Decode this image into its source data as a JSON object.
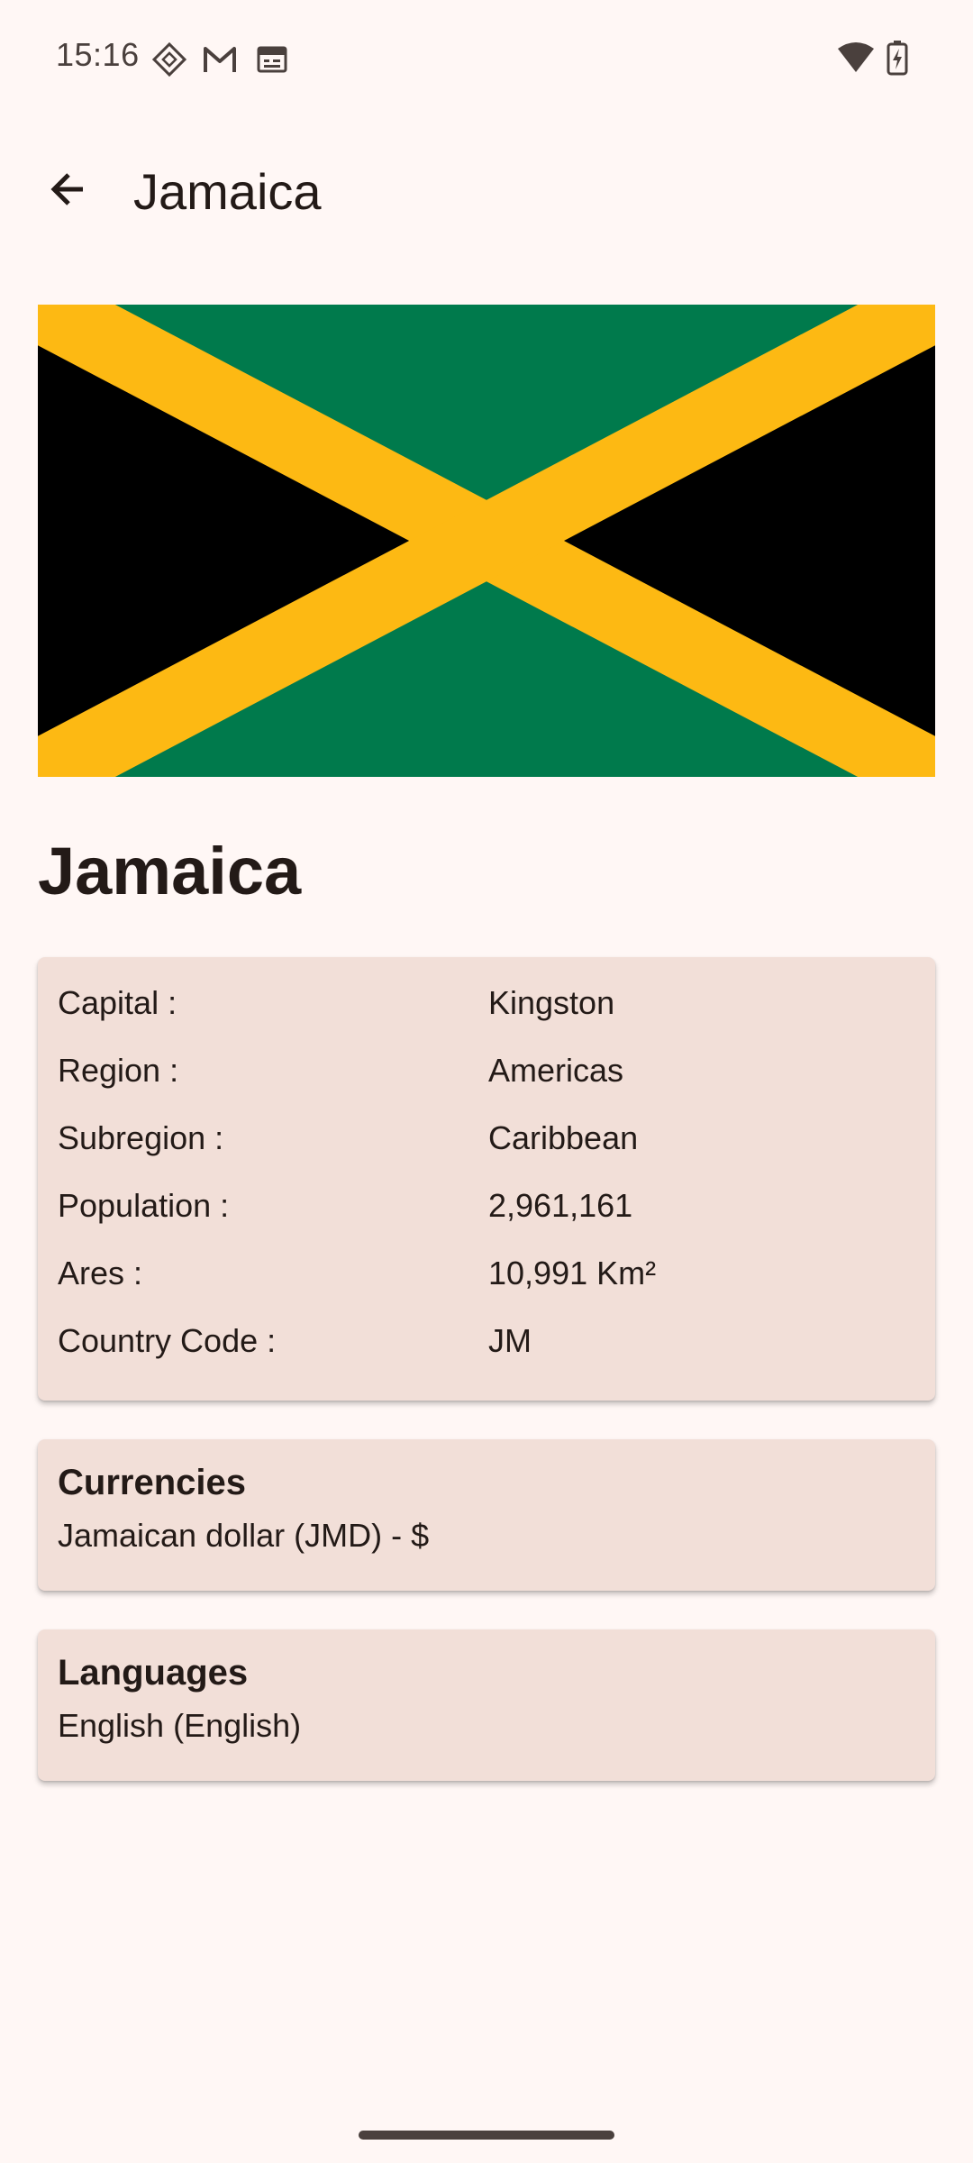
{
  "status_bar": {
    "time": "15:16",
    "icons_left": [
      "assistant-icon",
      "gmail-icon",
      "calendar-icon"
    ],
    "icons_right": [
      "wifi-icon",
      "battery-charging-icon"
    ]
  },
  "top_bar": {
    "back_icon": "arrow-back-icon",
    "title": "Jamaica"
  },
  "flag": {
    "country": "Jamaica",
    "colors": {
      "green": "#007A4C",
      "gold": "#FDB913",
      "black": "#000000"
    }
  },
  "country_name": "Jamaica",
  "info": {
    "rows": [
      {
        "label": "Capital :",
        "value": "Kingston"
      },
      {
        "label": "Region :",
        "value": "Americas"
      },
      {
        "label": "Subregion :",
        "value": "Caribbean"
      },
      {
        "label": "Population :",
        "value": "2,961,161"
      },
      {
        "label": "Ares :",
        "value": "10,991 Km²"
      },
      {
        "label": "Country Code :",
        "value": "JM"
      }
    ]
  },
  "currencies": {
    "heading": "Currencies",
    "text": "Jamaican dollar (JMD) - $"
  },
  "languages": {
    "heading": "Languages",
    "text": "English (English)"
  },
  "theme": {
    "background": "#fff7f5",
    "card": "#f2dfd8",
    "text": "#231a17"
  }
}
